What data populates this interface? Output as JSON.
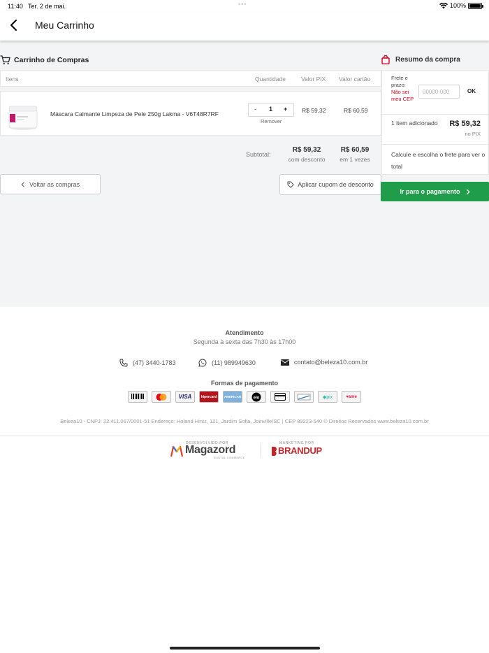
{
  "status_bar": {
    "time": "11:40",
    "date": "Ter. 2 de mai.",
    "battery": "100%"
  },
  "header": {
    "title": "Meu Carrinho"
  },
  "cart": {
    "heading": "Carrinho de Compras",
    "columns": {
      "items": "Itens",
      "quantity": "Quantidade",
      "pix": "Valor PIX",
      "card": "Valor cartão"
    },
    "items": [
      {
        "name": "Máscara Calmante Limpeza de Pele 250g Lakma - V6T48R7RF",
        "quantity": "1",
        "price_pix": "R$ 59,32",
        "price_card": "R$ 60,59",
        "remove": "Remover"
      }
    ],
    "qty_minus": "-",
    "qty_plus": "+",
    "subtotal_label": "Subtotal:",
    "subtotal_pix": "R$ 59,32",
    "subtotal_pix_note": "com desconto",
    "subtotal_card": "R$ 60,59",
    "subtotal_card_note": "em 1 vezes",
    "back_button": "Voltar as compras",
    "coupon_button": "Aplicar cupom de desconto"
  },
  "summary": {
    "heading": "Resumo da compra",
    "freight_label": "Frete e prazo:",
    "freight_link": "Não sei meu CEP",
    "cep_placeholder": "00000-000",
    "ok": "OK",
    "items_added": "1 item adicionado",
    "total": "R$ 59,32",
    "total_note": "no PIX",
    "calc_note": "Calcule e escolha o frete para ver o total",
    "pay_button": "Ir para o pagamento"
  },
  "footer": {
    "attendance_title": "Atendimento",
    "attendance_hours": "Segunda à sexta das 7h30 às 17h00",
    "phone": "(47) 3440-1783",
    "whatsapp": "(11) 989949630",
    "email": "contato@beleza10.com.br",
    "payment_title": "Formas de pagamento",
    "payment_methods": [
      "boleto",
      "mastercard",
      "VISA",
      "hipercard",
      "amex",
      "elo",
      "card",
      "diners",
      "pix",
      "ame"
    ],
    "legal": "Beleza10 - CNPJ: 22.411.067/0001-51 Endereço: Holand Hintz, 121, Jardim Sofia, Joinville/SC | CEP 89223-540 © Direitos Reservados www.beleza10.com.br",
    "dev_caption": "DESENVOLVIDO POR",
    "dev_brand": "Magazord",
    "dev_sub": "DIGITAL COMMERCE",
    "mkt_caption": "MARKETING POR",
    "mkt_brand": "BRANDUP"
  },
  "colors": {
    "primary_green": "#1f9d4a",
    "alert_red": "#d0021b",
    "page_bg": "#f3f4f6"
  }
}
